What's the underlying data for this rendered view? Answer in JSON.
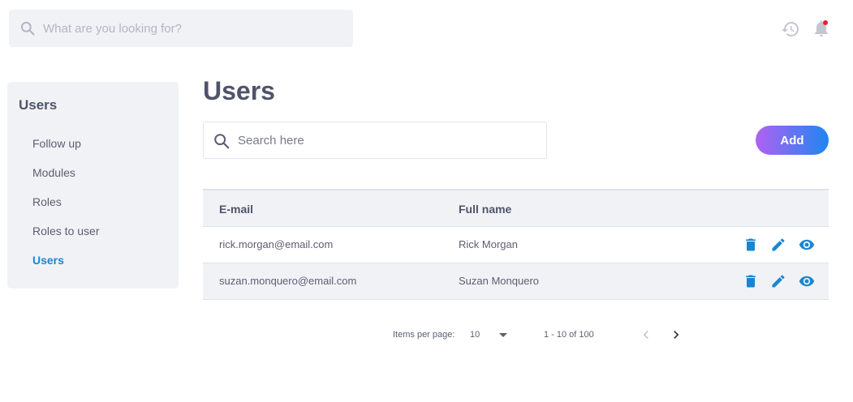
{
  "header": {
    "search_placeholder": "What are you looking for?",
    "icons": [
      "search-icon",
      "history-icon",
      "bell-icon"
    ]
  },
  "sidebar": {
    "title": "Users",
    "items": [
      {
        "label": "Follow up",
        "active": false
      },
      {
        "label": "Modules",
        "active": false
      },
      {
        "label": "Roles",
        "active": false
      },
      {
        "label": "Roles to user",
        "active": false
      },
      {
        "label": "Users",
        "active": true
      }
    ]
  },
  "main": {
    "title": "Users",
    "search_placeholder": "Search here",
    "add_label": "Add"
  },
  "table": {
    "columns": [
      "E-mail",
      "Full name"
    ],
    "rows": [
      {
        "email": "rick.morgan@email.com",
        "name": "Rick Morgan",
        "actions": [
          "delete-icon",
          "edit-icon",
          "view-icon"
        ]
      },
      {
        "email": "suzan.monquero@email.com",
        "name": "Suzan Monquero",
        "actions": [
          "delete-icon",
          "edit-icon",
          "view-icon"
        ]
      }
    ]
  },
  "pagination": {
    "items_per_page_label": "Items per page:",
    "items_per_page_value": "10",
    "range_label": "1 - 10 of 100"
  },
  "colors": {
    "accent": "#1a86d0",
    "add_gradient_start": "#b061f2",
    "add_gradient_end": "#1f86f0",
    "notification_dot": "#e5202e"
  }
}
